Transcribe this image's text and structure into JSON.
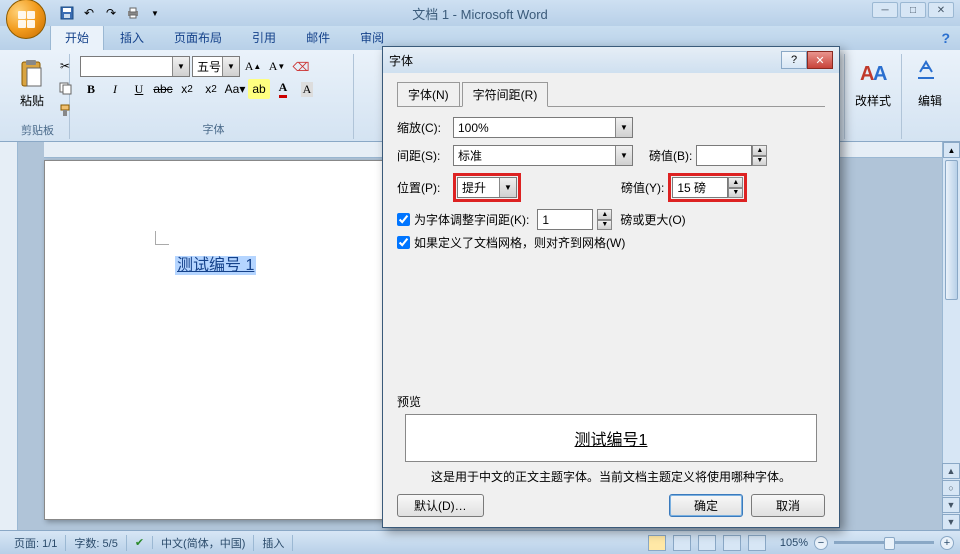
{
  "title": "文档 1 - Microsoft Word",
  "tabs": [
    "开始",
    "插入",
    "页面布局",
    "引用",
    "邮件",
    "审阅"
  ],
  "clipboard": {
    "paste": "粘贴",
    "group": "剪贴板"
  },
  "font": {
    "size": "五号",
    "group": "字体",
    "bold": "B",
    "italic": "I",
    "underline": "U",
    "strike": "abc"
  },
  "rightGroups": {
    "styles": "改样式",
    "editing": "编辑"
  },
  "document": {
    "text": "测试编号 1"
  },
  "status": {
    "page": "页面: 1/1",
    "words": "字数: 5/5",
    "lang": "中文(简体，中国)",
    "mode": "插入",
    "zoom": "105%"
  },
  "dialog": {
    "title": "字体",
    "tab_font": "字体(N)",
    "tab_spacing": "字符间距(R)",
    "scale_lbl": "缩放(C):",
    "scale_val": "100%",
    "spacing_lbl": "间距(S):",
    "spacing_val": "标准",
    "spacing_by_lbl": "磅值(B):",
    "spacing_by_val": "",
    "pos_lbl": "位置(P):",
    "pos_val": "提升",
    "pos_by_lbl": "磅值(Y):",
    "pos_by_val": "15 磅",
    "kerning": "为字体调整字间距(K):",
    "kerning_val": "1",
    "kerning_suffix": "磅或更大(O)",
    "snap": "如果定义了文档网格，则对齐到网格(W)",
    "preview_lbl": "预览",
    "preview_text": "测试编号1",
    "preview_hint": "这是用于中文的正文主题字体。当前文档主题定义将使用哪种字体。",
    "default_btn": "默认(D)…",
    "ok": "确定",
    "cancel": "取消"
  }
}
